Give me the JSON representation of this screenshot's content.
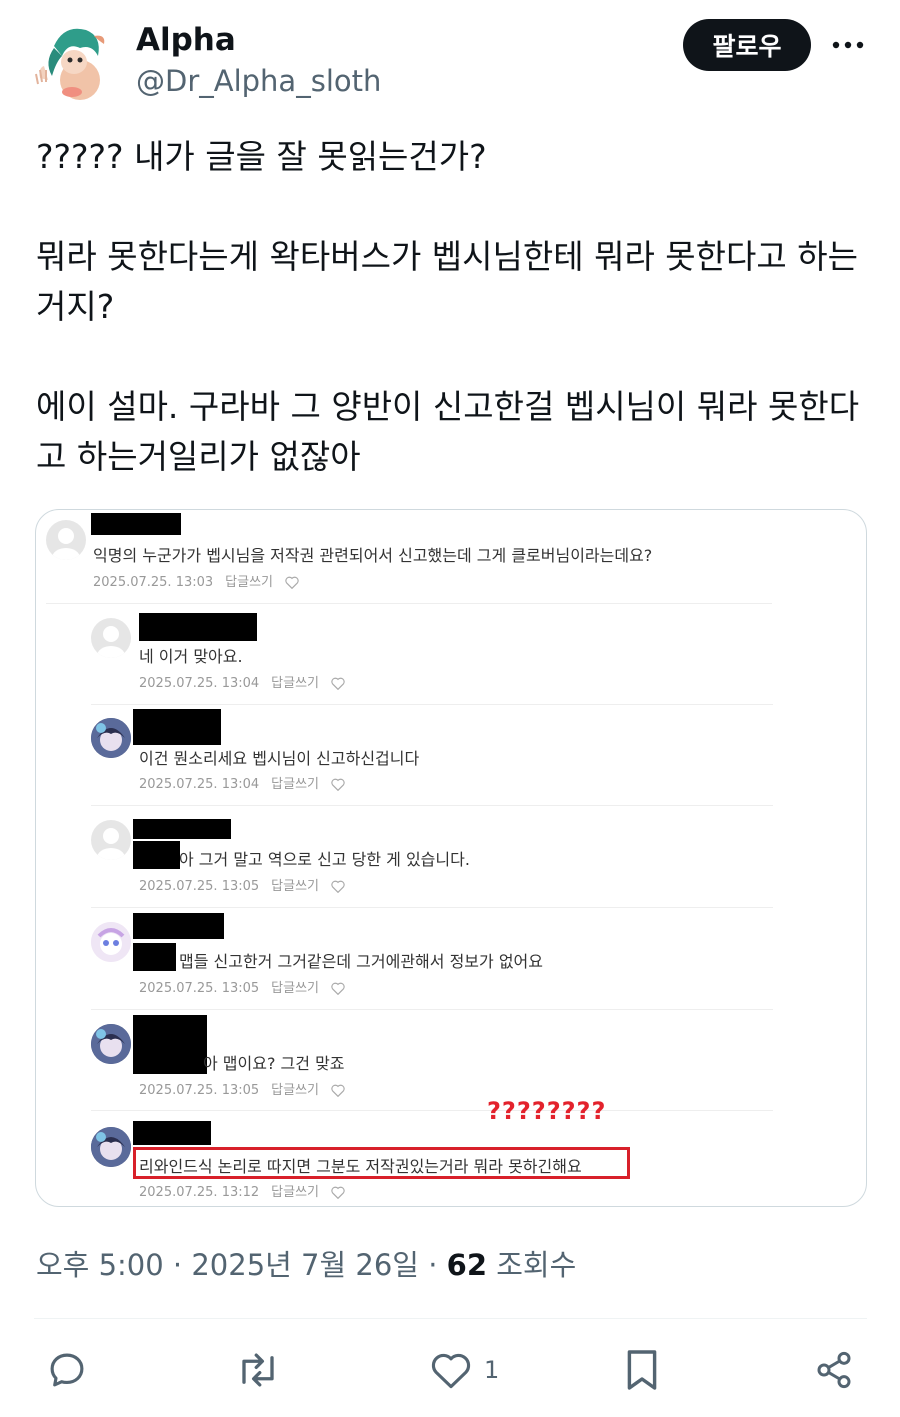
{
  "author": {
    "name": "Alpha",
    "handle": "@Dr_Alpha_sloth",
    "follow_label": "팔로우"
  },
  "tweet": {
    "line1": "????? 내가 글을 잘 못읽는건가?",
    "line2": "뭐라 못한다는게 왁타버스가 벱시님한테 뭐라 못한다고 하는",
    "line3": "거지?",
    "line4": "에이 설마. 구라바 그 양반이 신고한걸 벱시님이 뭐라 못한다",
    "line5": "고 하는거일리가 없잖아"
  },
  "media": {
    "comments": [
      {
        "text": "익명의 누군가가 벱시님을 저작권 관련되어서 신고했는데 그게 클로버님이라는데요?",
        "date": "2025.07.25. 13:03",
        "reply": "답글쓰기"
      },
      {
        "text": "네 이거 맞아요.",
        "date": "2025.07.25. 13:04",
        "reply": "답글쓰기"
      },
      {
        "text": "이건 뭔소리세요 벱시님이 신고하신겁니다",
        "date": "2025.07.25. 13:04",
        "reply": "답글쓰기"
      },
      {
        "text": "아 그거 말고 역으로 신고 당한 게 있습니다.",
        "date": "2025.07.25. 13:05",
        "reply": "답글쓰기"
      },
      {
        "text": "맵들 신고한거 그거같은데 그거에관해서 정보가 없어요",
        "date": "2025.07.25. 13:05",
        "reply": "답글쓰기"
      },
      {
        "text": "아 맵이요? 그건 맞죠",
        "date": "2025.07.25. 13:05",
        "reply": "답글쓰기"
      },
      {
        "text": "리와인드식 논리로 따지면 그분도 저작권있는거라 뭐라 못하긴해요",
        "date": "2025.07.25. 13:12",
        "reply": "답글쓰기"
      }
    ],
    "annotation": "????????"
  },
  "meta": {
    "time": "오후 5:00",
    "dot1": "·",
    "date": "2025년 7월 26일",
    "dot2": "·",
    "views": "62",
    "views_label": "조회수"
  },
  "actions": {
    "like_count": "1"
  },
  "colors": {
    "text": "#0f1419",
    "secondary": "#536471",
    "border": "#cfd9de",
    "annotation_red": "#e3222c"
  }
}
